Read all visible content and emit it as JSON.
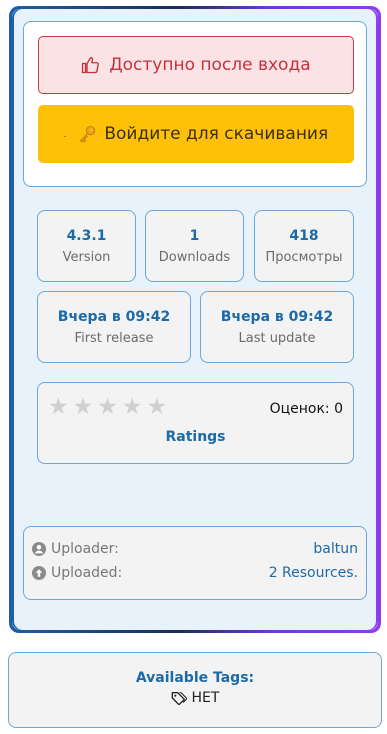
{
  "actions": {
    "locked_label": "Доступно после входа",
    "login_label": "Войдите для скачивания",
    "login_dot": "."
  },
  "stats": {
    "version": {
      "value": "4.3.1",
      "label": "Version"
    },
    "downloads": {
      "value": "1",
      "label": "Downloads"
    },
    "views": {
      "value": "418",
      "label": "Просмотры"
    },
    "first_release": {
      "value": "Вчера в 09:42",
      "label": "First release"
    },
    "last_update": {
      "value": "Вчера в 09:42",
      "label": "Last update"
    }
  },
  "rating": {
    "stars_filled": 0,
    "stars_total": 5,
    "count_label": "Оценок: 0",
    "link_label": "Ratings"
  },
  "info": {
    "uploader_label": "Uploader:",
    "uploader_value": "baltun",
    "uploaded_label": "Uploaded:",
    "uploaded_value": "2 Resources."
  },
  "tags": {
    "title": "Available Tags:",
    "items": [
      "НЕТ"
    ]
  },
  "colors": {
    "accent": "#1d6aa8",
    "login_button": "#ffc107",
    "locked_button_text": "#c3323b",
    "panel_bg": "#e8f2fb",
    "border": "#6aa7da"
  }
}
